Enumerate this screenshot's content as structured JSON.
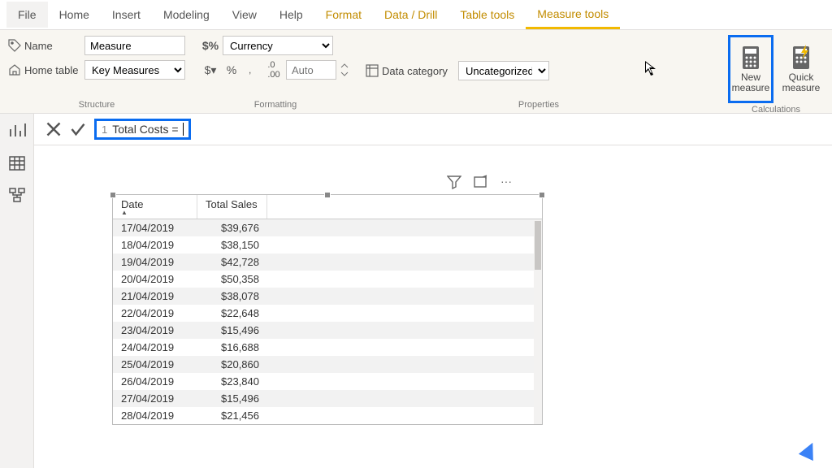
{
  "tabs": {
    "file": "File",
    "home": "Home",
    "insert": "Insert",
    "modeling": "Modeling",
    "view": "View",
    "help": "Help",
    "format": "Format",
    "datadrill": "Data / Drill",
    "tabletools": "Table tools",
    "measuretools": "Measure tools"
  },
  "structure": {
    "name_label": "Name",
    "name_value": "Measure",
    "table_label": "Home table",
    "table_value": "Key Measures",
    "group": "Structure"
  },
  "formatting": {
    "format_value": "Currency",
    "auto_placeholder": "Auto",
    "dollar": "$",
    "percent": "%",
    "comma": ",",
    "decimals": ".00",
    "group": "Formatting"
  },
  "properties": {
    "category_label": "Data category",
    "category_value": "Uncategorized",
    "group": "Properties"
  },
  "calculations": {
    "new": "New measure",
    "quick": "Quick measure",
    "group": "Calculations"
  },
  "formula": {
    "line": "1",
    "text": "Total Costs = "
  },
  "viz_icons": {
    "filter": "filter",
    "focus": "focus",
    "more": "···"
  },
  "table": {
    "headers": {
      "date": "Date",
      "sales": "Total Sales"
    },
    "rows": [
      {
        "date": "17/04/2019",
        "sales": "$39,676"
      },
      {
        "date": "18/04/2019",
        "sales": "$38,150"
      },
      {
        "date": "19/04/2019",
        "sales": "$42,728"
      },
      {
        "date": "20/04/2019",
        "sales": "$50,358"
      },
      {
        "date": "21/04/2019",
        "sales": "$38,078"
      },
      {
        "date": "22/04/2019",
        "sales": "$22,648"
      },
      {
        "date": "23/04/2019",
        "sales": "$15,496"
      },
      {
        "date": "24/04/2019",
        "sales": "$16,688"
      },
      {
        "date": "25/04/2019",
        "sales": "$20,860"
      },
      {
        "date": "26/04/2019",
        "sales": "$23,840"
      },
      {
        "date": "27/04/2019",
        "sales": "$15,496"
      },
      {
        "date": "28/04/2019",
        "sales": "$21,456"
      }
    ]
  }
}
